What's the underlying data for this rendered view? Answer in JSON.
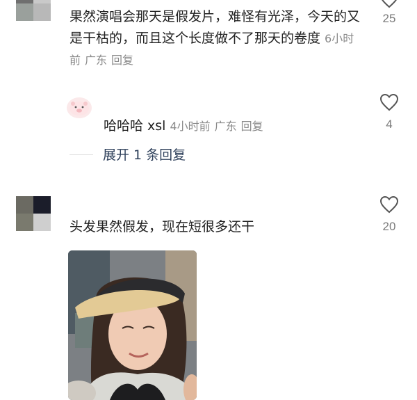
{
  "comments": [
    {
      "text": "果然演唱会那天是假发片，难怪有光泽，今天的又是干枯的，而且这个长度做不了那天的卷度",
      "time": "6小时前",
      "location": "广东",
      "reply_label": "回复",
      "likes": "25",
      "reply": {
        "username": "哈哈哈 xsl",
        "time": "4小时前",
        "location": "广东",
        "reply_label": "回复",
        "likes": "4"
      },
      "expand_label": "展开 1 条回复"
    },
    {
      "text": "头发果然假发，现在短很多还干",
      "likes": "20"
    }
  ],
  "icons": {
    "like": "heart-outline-icon"
  },
  "colors": {
    "meta": "#8a8a8a",
    "link": "#2d3f5a",
    "text": "#222222"
  }
}
